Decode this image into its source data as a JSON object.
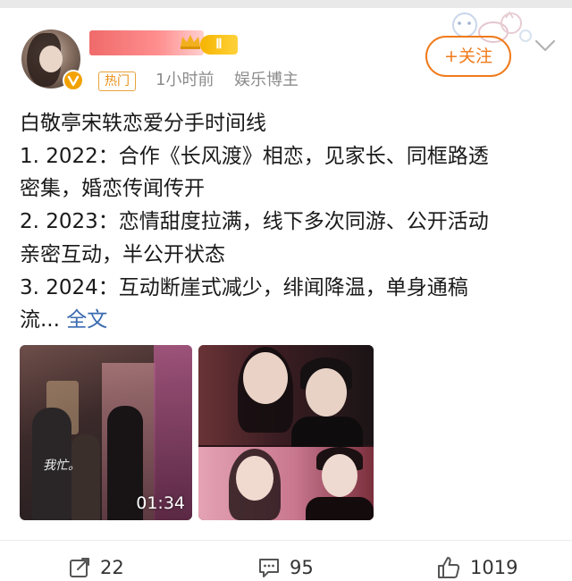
{
  "post": {
    "author": {
      "level_badge": "Ⅱ",
      "verified_icon": "verified-v-icon"
    },
    "hot_tag": "热门",
    "time": "1小时前",
    "role": "娱乐博主",
    "follow_label": "+关注",
    "text_lines": [
      "白敬亭宋轶恋爱分手时间线",
      "1. 2022：合作《长风渡》相恋，见家长、同框路透",
      "密集，婚恋传闻传开",
      "2. 2023：恋情甜度拉满，线下多次同游、公开活动",
      "亲密互动，半公开状态",
      "3. 2024：互动断崖式减少，绯闻降温，单身通稿"
    ],
    "truncated_prefix": "流...",
    "more_link": "全文",
    "images": [
      {
        "caption": "我忙。",
        "duration": "01:34"
      },
      {
        "caption": ""
      }
    ],
    "actions": {
      "repost_count": "22",
      "comment_count": "95",
      "like_count": "1019"
    }
  },
  "colors": {
    "accent_orange": "#f07a1a",
    "hot_tag": "#e88f1a",
    "link_blue": "#3a6ab0",
    "meta_gray": "#8c8c8c"
  },
  "icons": [
    "verified-v-icon",
    "crown-icon",
    "chevron-down-icon",
    "repost-icon",
    "comment-icon",
    "like-icon"
  ]
}
